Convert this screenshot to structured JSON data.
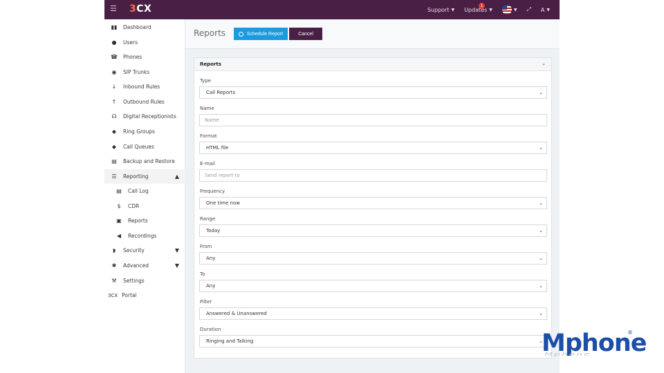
{
  "topbar": {
    "menu_icon": "hamburger-icon",
    "logo_three": "3",
    "logo_cx": "CX",
    "support_label": "Support",
    "updates_label": "Updates",
    "updates_badge": "1",
    "language_icon": "us-flag-icon",
    "fullscreen_icon": "expand-icon",
    "user_label": "A"
  },
  "sidebar": {
    "items": [
      {
        "label": "Dashboard",
        "icon": "bar-chart-icon",
        "glyph": "▮▮"
      },
      {
        "label": "Users",
        "icon": "user-icon",
        "glyph": "●"
      },
      {
        "label": "Phones",
        "icon": "phone-icon",
        "glyph": "☎"
      },
      {
        "label": "SIP Trunks",
        "icon": "globe-icon",
        "glyph": "◉"
      },
      {
        "label": "Inbound Rules",
        "icon": "arrow-down-icon",
        "glyph": "↓"
      },
      {
        "label": "Outbound Rules",
        "icon": "arrow-up-icon",
        "glyph": "↑"
      },
      {
        "label": "Digital Receptionists",
        "icon": "headset-icon",
        "glyph": "☊"
      },
      {
        "label": "Ring Groups",
        "icon": "group-icon",
        "glyph": "◆"
      },
      {
        "label": "Call Queues",
        "icon": "users-icon",
        "glyph": "◆"
      },
      {
        "label": "Backup and Restore",
        "icon": "database-icon",
        "glyph": "▤"
      },
      {
        "label": "Reporting",
        "icon": "list-icon",
        "glyph": "☰"
      },
      {
        "label": "Call Log",
        "icon": "document-icon",
        "glyph": "▤"
      },
      {
        "label": "CDR",
        "icon": "dollar-icon",
        "glyph": "$"
      },
      {
        "label": "Reports",
        "icon": "report-icon",
        "glyph": "▣"
      },
      {
        "label": "Recordings",
        "icon": "speaker-icon",
        "glyph": "◀"
      },
      {
        "label": "Security",
        "icon": "shield-icon",
        "glyph": "◗"
      },
      {
        "label": "Advanced",
        "icon": "gear-icon",
        "glyph": "✱"
      },
      {
        "label": "Settings",
        "icon": "wrench-icon",
        "glyph": "⚒"
      },
      {
        "label": "Portal",
        "icon": "3cx-icon",
        "glyph": "3CX"
      }
    ]
  },
  "header": {
    "title": "Reports",
    "schedule_label": "Schedule Report",
    "cancel_label": "Cancel"
  },
  "card": {
    "title": "Reports",
    "fields": {
      "type": {
        "label": "Type",
        "value": "Call Reports"
      },
      "name": {
        "label": "Name",
        "placeholder": "Name"
      },
      "format": {
        "label": "Format",
        "value": "HTML file"
      },
      "email": {
        "label": "E-mail",
        "placeholder": "Send report to"
      },
      "frequency": {
        "label": "Frequency",
        "value": "One time now"
      },
      "range": {
        "label": "Range",
        "value": "Today"
      },
      "from": {
        "label": "From",
        "value": "Any"
      },
      "to": {
        "label": "To",
        "value": "Any"
      },
      "filter": {
        "label": "Filter",
        "value": "Answered & Unanswered"
      },
      "duration": {
        "label": "Duration",
        "value": "Ringing and Talking"
      }
    }
  },
  "watermark": {
    "brand": "Mphone",
    "reg": "®",
    "reflection": "Mphone"
  },
  "colors": {
    "topbar": "#4a1f45",
    "accent": "#1a9be0",
    "brand_mark": "#ff6a3d"
  }
}
